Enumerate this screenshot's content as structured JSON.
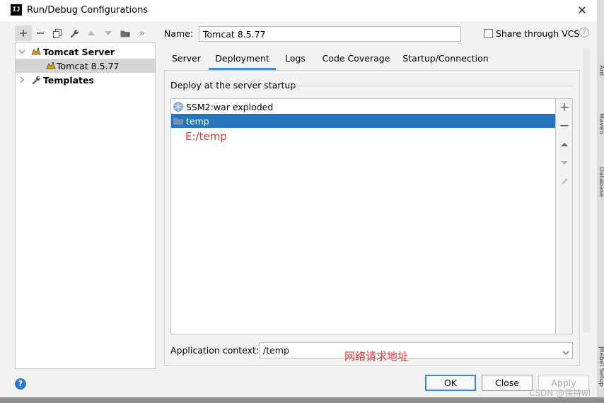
{
  "window": {
    "title": "Run/Debug Configurations",
    "app_icon": "IJ",
    "close_glyph": "✕"
  },
  "toolbar": {
    "icons": [
      "add-icon",
      "remove-icon",
      "copy-icon",
      "wrench-icon",
      "move-up-icon",
      "move-down-icon",
      "folder-icon",
      "more-icon"
    ],
    "more_glyph": "»"
  },
  "tree": {
    "items": [
      {
        "label": "Tomcat Server",
        "bold": true,
        "expanded": true
      },
      {
        "label": "Tomcat 8.5.77",
        "selected": true
      },
      {
        "label": "Templates",
        "bold": true,
        "expanded": false
      }
    ]
  },
  "form": {
    "name_label": "Name:",
    "name_value": "Tomcat 8.5.77",
    "share_label": "Share through VCS",
    "share_checked": false,
    "help_glyph": "?"
  },
  "tabs": [
    {
      "label": "Server",
      "active": false
    },
    {
      "label": "Deployment",
      "active": true
    },
    {
      "label": "Logs",
      "active": false
    },
    {
      "label": "Code Coverage",
      "active": false
    },
    {
      "label": "Startup/Connection",
      "active": false
    }
  ],
  "deployment": {
    "section_label": "Deploy at the server startup",
    "items": [
      {
        "label": "SSM2:war exploded",
        "icon": "artifact-icon",
        "selected": false
      },
      {
        "label": "temp",
        "icon": "folder-icon",
        "selected": true
      }
    ],
    "side_tools": {
      "add_glyph": "+",
      "remove_glyph": "−"
    },
    "annotation_path": "E:/temp",
    "context_label": "Application context:",
    "context_value": "/temp",
    "annotation_context": "网络请求地址"
  },
  "buttons": {
    "help": "?",
    "ok": "OK",
    "close": "Close",
    "apply": "Apply"
  },
  "ide_sidebar": {
    "ant": "Ant",
    "maven": "Maven",
    "database": "Database",
    "jrebel": "JRebel Setup"
  },
  "watermark": "CSDN @保持wl",
  "colors": {
    "selection": "#2675bf",
    "tab_underline": "#4a88c7",
    "annotation": "#e8362f",
    "ok_border": "#3c84d6",
    "help_blue": "#2c7bd0"
  }
}
